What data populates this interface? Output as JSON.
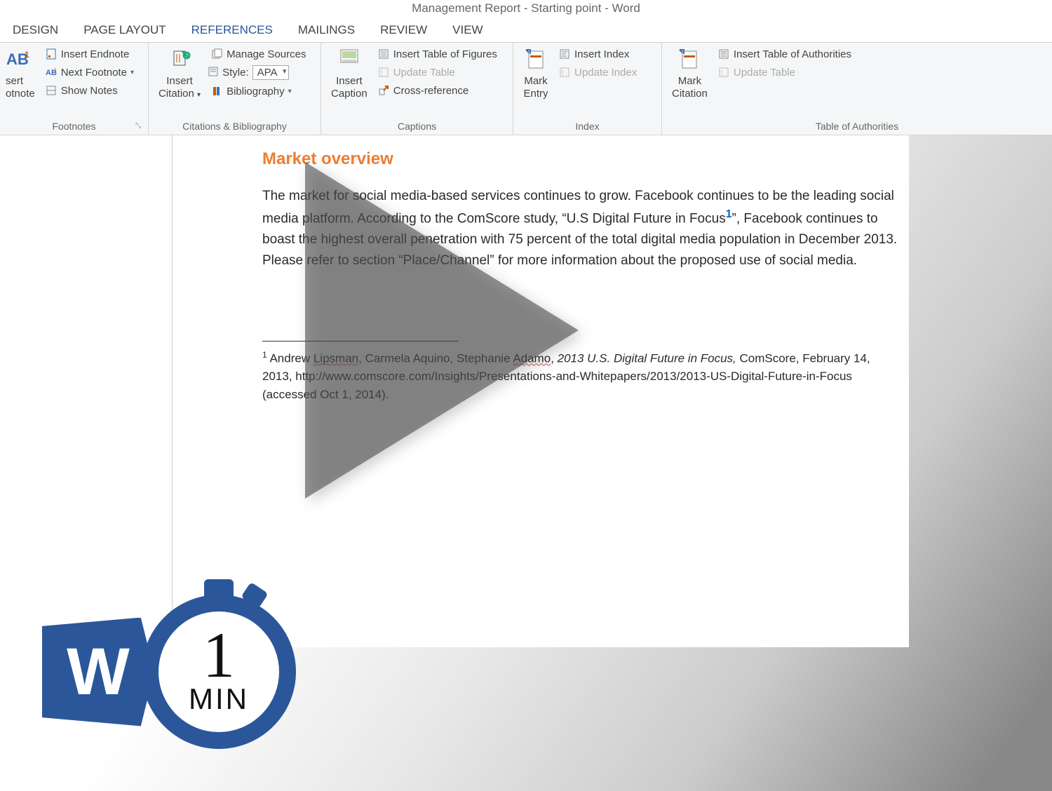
{
  "title": "Management Report - Starting point - Word",
  "tabs": [
    {
      "label": "DESIGN"
    },
    {
      "label": "PAGE LAYOUT"
    },
    {
      "label": "REFERENCES"
    },
    {
      "label": "MAILINGS"
    },
    {
      "label": "REVIEW"
    },
    {
      "label": "VIEW"
    }
  ],
  "ribbon": {
    "footnote": {
      "big_label_l1": "sert",
      "big_label_l2": "otnote",
      "insert_endnote": "Insert Endnote",
      "next_footnote": "Next Footnote",
      "show_notes": "Show Notes",
      "group": "Footnotes"
    },
    "citations": {
      "insert_citation": "Insert\nCitation",
      "manage_sources": "Manage Sources",
      "style_label": "Style:",
      "style_value": "APA",
      "bibliography": "Bibliography",
      "group": "Citations & Bibliography"
    },
    "captions": {
      "insert_caption": "Insert\nCaption",
      "table_figures": "Insert Table of Figures",
      "update_table": "Update Table",
      "cross_ref": "Cross-reference",
      "group": "Captions"
    },
    "index": {
      "mark_entry": "Mark\nEntry",
      "insert_index": "Insert Index",
      "update_index": "Update Index",
      "group": "Index"
    },
    "authorities": {
      "mark_citation": "Mark\nCitation",
      "table_auth": "Insert Table of Authorities",
      "update_table": "Update Table",
      "group": "Table of Authorities"
    }
  },
  "document": {
    "heading": "Market overview",
    "para_pre": "The market for social media-based services continues to grow. Facebook continues to be the leading social media platform.  According to the ComScore study, “U.S Digital Future in Focus",
    "fn_marker": "1",
    "para_post": "”, Facebook continues to boast the highest overall penetration with 75 percent of the total digital media population in December 2013. Please refer to section “Place/Channel” for more information about the proposed use of social media.",
    "footnote_num": "1",
    "fn_author1_pre": " Andrew ",
    "fn_author1_sq": "Lipsman",
    "fn_authors_mid": ", Carmela Aquino, Stephanie ",
    "fn_author3_sq": "Adamo",
    "fn_sep": ", ",
    "fn_title_ital": "2013 U.S. Digital Future in Focus,",
    "fn_rest": " ComScore, February 14, 2013, http://www.comscore.com/Insights/Presentations-and-Whitepapers/2013/2013-US-Digital-Future-in-Focus (accessed Oct 1, 2014)."
  },
  "badge": {
    "letter": "W",
    "num": "1",
    "unit": "MIN"
  }
}
